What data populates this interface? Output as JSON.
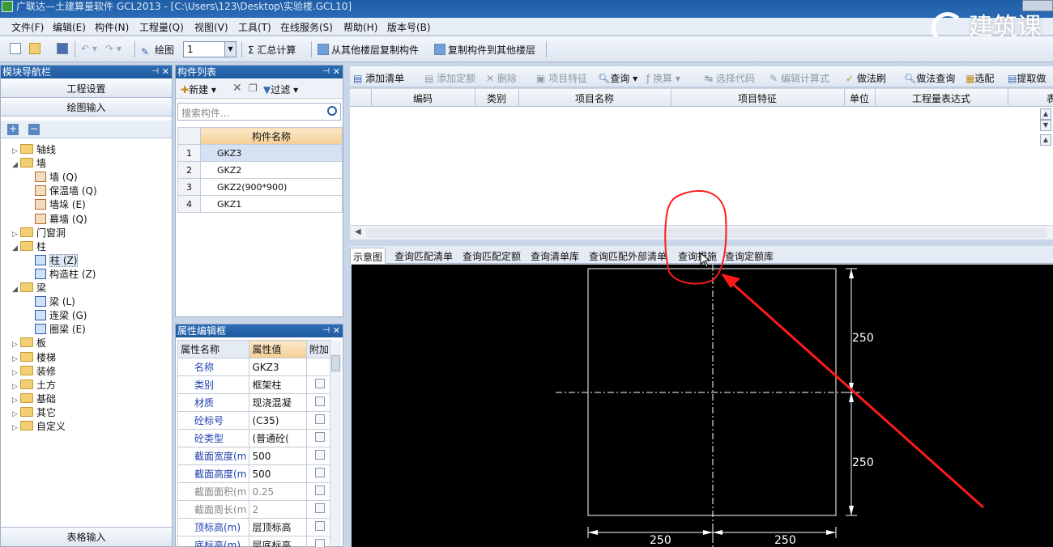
{
  "window": {
    "title": "广联达—土建算量软件 GCL2013 - [C:\\Users\\123\\Desktop\\实验楼.GCL10]"
  },
  "menu": [
    "文件(F)",
    "编辑(E)",
    "构件(N)",
    "工程量(Q)",
    "视图(V)",
    "工具(T)",
    "在线服务(S)",
    "帮助(H)",
    "版本号(B)"
  ],
  "brand": {
    "text": "建筑课"
  },
  "toolbar": {
    "draw_label": "绘图",
    "floor_value": "1",
    "sum_label": "Σ 汇总计算",
    "copy_from_label": "从其他楼层复制构件",
    "copy_to_label": "复制构件到其他楼层"
  },
  "nav": {
    "title": "模块导航栏",
    "project_settings": "工程设置",
    "drawing_input": "绘图输入",
    "table_input": "表格输入",
    "tree": [
      {
        "label": "轴线",
        "level": 0,
        "twisty": "▷",
        "icon": "folder"
      },
      {
        "label": "墙",
        "level": 0,
        "twisty": "◢",
        "icon": "folder"
      },
      {
        "label": "墙 (Q)",
        "level": 1,
        "icon": "wall"
      },
      {
        "label": "保温墙 (Q)",
        "level": 1,
        "icon": "wall"
      },
      {
        "label": "墙垛 (E)",
        "level": 1,
        "icon": "wall"
      },
      {
        "label": "幕墙 (Q)",
        "level": 1,
        "icon": "wall"
      },
      {
        "label": "门窗洞",
        "level": 0,
        "twisty": "▷",
        "icon": "folder"
      },
      {
        "label": "柱",
        "level": 0,
        "twisty": "◢",
        "icon": "folder"
      },
      {
        "label": "柱 (Z)",
        "level": 1,
        "icon": "column",
        "selected": true
      },
      {
        "label": "构造柱 (Z)",
        "level": 1,
        "icon": "column"
      },
      {
        "label": "梁",
        "level": 0,
        "twisty": "◢",
        "icon": "folder"
      },
      {
        "label": "梁 (L)",
        "level": 1,
        "icon": "beam"
      },
      {
        "label": "连梁 (G)",
        "level": 1,
        "icon": "beam"
      },
      {
        "label": "圈梁 (E)",
        "level": 1,
        "icon": "beam"
      },
      {
        "label": "板",
        "level": 0,
        "twisty": "▷",
        "icon": "folder"
      },
      {
        "label": "楼梯",
        "level": 0,
        "twisty": "▷",
        "icon": "folder"
      },
      {
        "label": "装修",
        "level": 0,
        "twisty": "▷",
        "icon": "folder"
      },
      {
        "label": "土方",
        "level": 0,
        "twisty": "▷",
        "icon": "folder"
      },
      {
        "label": "基础",
        "level": 0,
        "twisty": "▷",
        "icon": "folder"
      },
      {
        "label": "其它",
        "level": 0,
        "twisty": "▷",
        "icon": "folder"
      },
      {
        "label": "自定义",
        "level": 0,
        "twisty": "▷",
        "icon": "folder"
      }
    ]
  },
  "components": {
    "title": "构件列表",
    "new_label": "新建",
    "filter_label": "过滤",
    "search_placeholder": "搜索构件...",
    "column_header": "构件名称",
    "rows": [
      {
        "index": "1",
        "name": "GKZ3",
        "selected": true
      },
      {
        "index": "2",
        "name": "GKZ2"
      },
      {
        "index": "3",
        "name": "GKZ2(900*900)"
      },
      {
        "index": "4",
        "name": "GKZ1"
      }
    ]
  },
  "properties": {
    "title": "属性编辑框",
    "headers": [
      "属性名称",
      "属性值",
      "附加"
    ],
    "rows": [
      {
        "name": "名称",
        "value": "GKZ3",
        "check": false
      },
      {
        "name": "类别",
        "value": "框架柱",
        "check": true
      },
      {
        "name": "材质",
        "value": "现浇混凝",
        "check": true
      },
      {
        "name": "砼标号",
        "value": "(C35)",
        "check": true
      },
      {
        "name": "砼类型",
        "value": "(普通砼(",
        "check": true
      },
      {
        "name": "截面宽度(m",
        "value": "500",
        "check": true
      },
      {
        "name": "截面高度(m",
        "value": "500",
        "check": true
      },
      {
        "name": "截面面积(m",
        "value": "0.25",
        "check": true,
        "dim": true
      },
      {
        "name": "截面周长(m",
        "value": "2",
        "check": true,
        "dim": true
      },
      {
        "name": "顶标高(m)",
        "value": "层顶标高",
        "check": true
      },
      {
        "name": "底标高(m)",
        "value": "层底标高",
        "check": true
      }
    ]
  },
  "right_toolbar": {
    "add_list": "添加清单",
    "add_quota": "添加定额",
    "delete": "删除",
    "item_feature": "项目特征",
    "query": "查询",
    "convert": "换算",
    "select_code": "选择代码",
    "edit_formula": "编辑计算式",
    "method_brush": "做法刷",
    "method_query": "做法查询",
    "match": "选配",
    "extract": "提取做"
  },
  "grid_headers": [
    "编码",
    "类别",
    "项目名称",
    "项目特征",
    "单位",
    "工程量表达式",
    "表"
  ],
  "bottom_tabs": [
    "示意图",
    "查询匹配清单",
    "查询匹配定额",
    "查询清单库",
    "查询匹配外部清单",
    "查询措施",
    "查询定额库"
  ],
  "diagram": {
    "dim_top": "250",
    "dim_bottom": "250",
    "dim_left": "250",
    "dim_right": "250"
  },
  "colors": {
    "accent": "#2e6db5",
    "annotation": "#ff1a1a",
    "canvas": "#000000"
  }
}
